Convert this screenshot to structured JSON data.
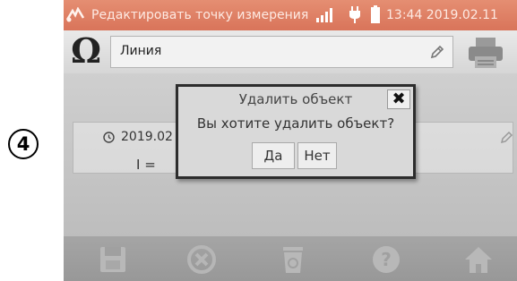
{
  "step_marker": "4",
  "status_bar": {
    "title": "Редактировать точку измерения",
    "time": "13:44 2019.02.11",
    "icons": [
      "measurement-app-icon",
      "signal-icon",
      "plug-icon",
      "battery-icon"
    ]
  },
  "header": {
    "icon": "ohm-icon",
    "ohm_symbol": "Ω",
    "name_value": "Линия",
    "edit_icon": "pencil-icon",
    "print_icon": "printer-icon"
  },
  "measurement": {
    "date": "2019.02",
    "current_label": "I ="
  },
  "dialog": {
    "title": "Удалить объект",
    "close_symbol": "✖",
    "question": "Вы хотите удалить объект?",
    "yes_label": "Да",
    "no_label": "Нет"
  },
  "toolbar": {
    "icons": [
      "save-icon",
      "cancel-icon",
      "trash-icon",
      "help-icon",
      "home-icon"
    ]
  },
  "colors": {
    "status_bar": "#d9745a",
    "screen_background": "#c7c7c7",
    "toolbar": "#9e9e9e",
    "dialog_border": "#2d2d2d"
  }
}
